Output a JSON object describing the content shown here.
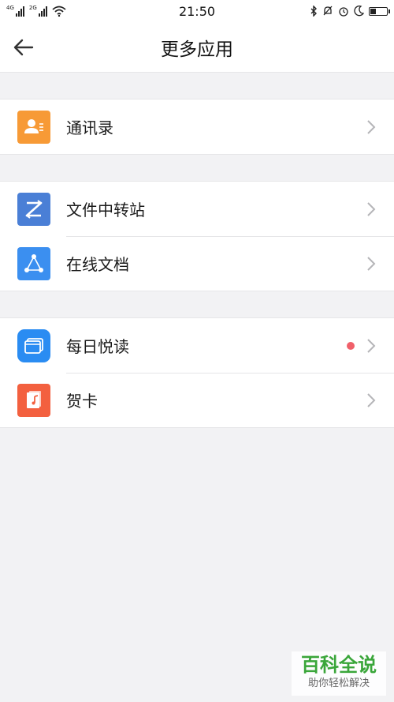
{
  "status_bar": {
    "time": "21:50",
    "sim1_label": "4G",
    "sim2_label": "2G"
  },
  "header": {
    "title": "更多应用"
  },
  "groups": [
    {
      "items": [
        {
          "label": "通讯录",
          "icon": "contacts-icon",
          "color": "#f79a36"
        }
      ]
    },
    {
      "items": [
        {
          "label": "文件中转站",
          "icon": "file-transfer-icon",
          "color": "#4a7fd6"
        },
        {
          "label": "在线文档",
          "icon": "online-doc-icon",
          "color": "#3b8ff0"
        }
      ]
    },
    {
      "items": [
        {
          "label": "每日悦读",
          "icon": "daily-reading-icon",
          "color": "#2a8cf2",
          "badge_color": "#f0606a"
        },
        {
          "label": "贺卡",
          "icon": "greeting-card-icon",
          "color": "#f3603f"
        }
      ]
    }
  ],
  "watermark": {
    "main": "百科全说",
    "sub": "助你轻松解决"
  }
}
